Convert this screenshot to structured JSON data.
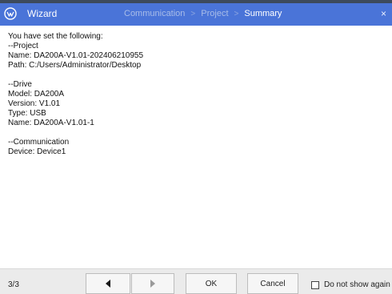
{
  "header": {
    "title": "Wizard",
    "close_label": "×",
    "steps": [
      {
        "label": "Communication",
        "active": false
      },
      {
        "label": "Project",
        "active": false
      },
      {
        "label": "Summary",
        "active": true
      }
    ],
    "step_separator": ">",
    "colors": {
      "header_bg": "#4a74d8",
      "inactive_step": "#a9bde8",
      "active_step": "#ffffff"
    }
  },
  "content": {
    "lines": [
      "You have set the following:",
      "--Project",
      "Name: DA200A-V1.01-202406210955",
      "Path: C:/Users/Administrator/Desktop",
      "",
      "--Drive",
      "Model: DA200A",
      "Version: V1.01",
      "Type: USB",
      "Name: DA200A-V1.01-1",
      "",
      "--Communication",
      "Device: Device1"
    ]
  },
  "footer": {
    "page_indicator": "3/3",
    "prev_icon": "arrow-left-icon",
    "next_icon": "arrow-right-icon",
    "ok_label": "OK",
    "cancel_label": "Cancel",
    "dont_show_label": "Do not show again",
    "dont_show_checked": false
  }
}
